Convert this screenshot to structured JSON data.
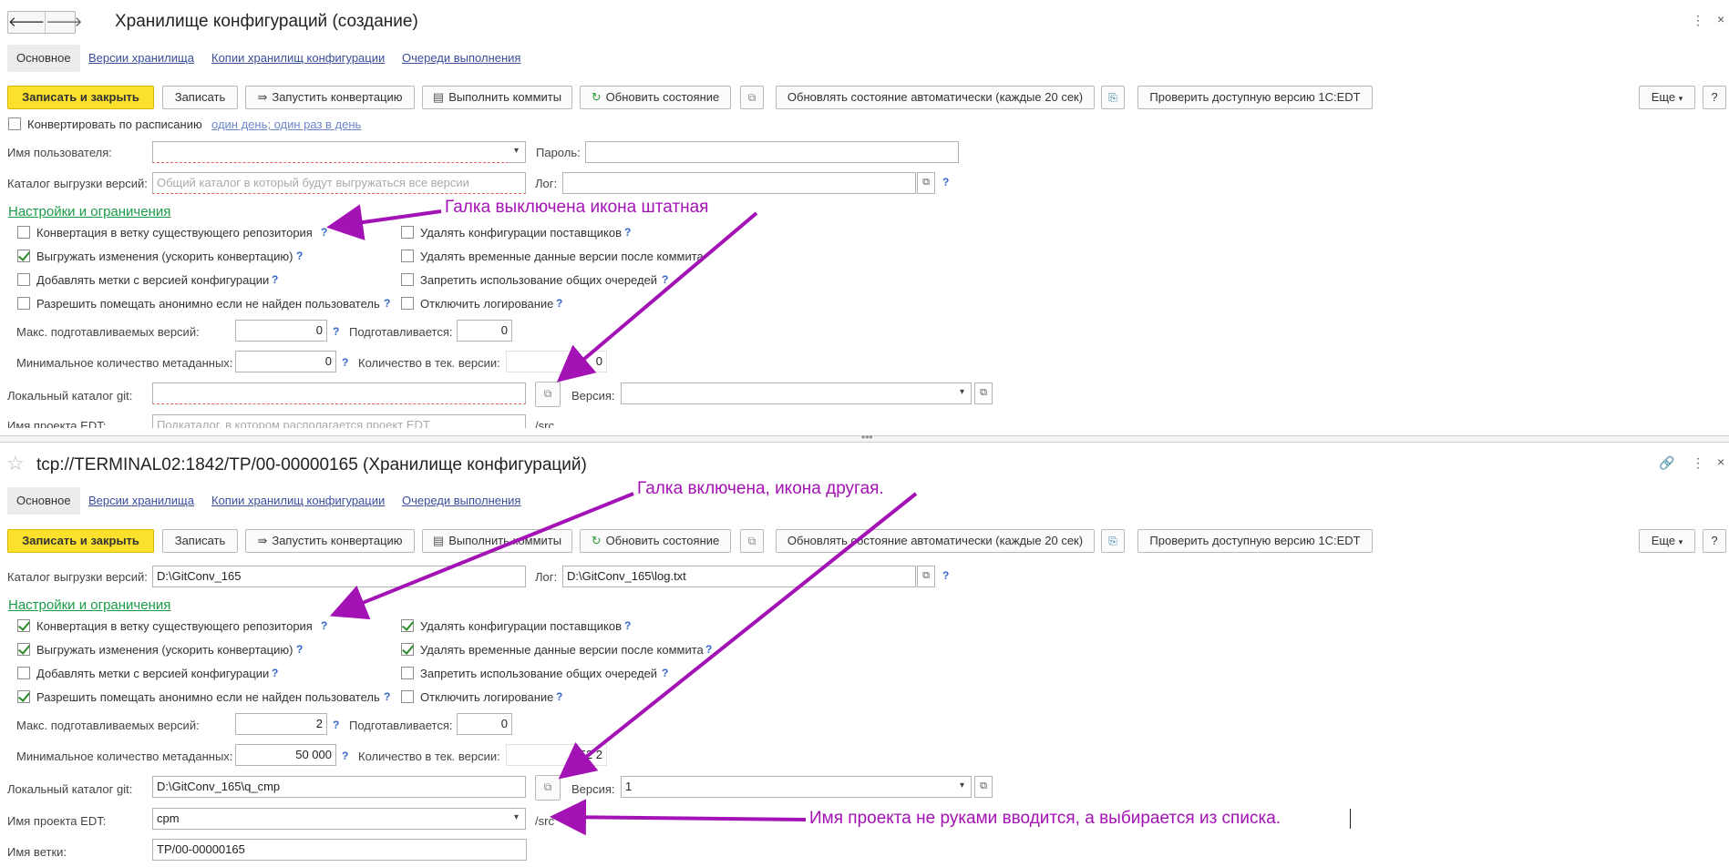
{
  "top": {
    "title": "Хранилище конфигураций (создание)",
    "tabs": {
      "main": "Основное",
      "versions": "Версии хранилища",
      "copies": "Копии хранилищ конфигурации",
      "queues": "Очереди выполнения"
    },
    "toolbar": {
      "save_close": "Записать и закрыть",
      "save": "Записать",
      "run": "Запустить конвертацию",
      "commits": "Выполнить коммиты",
      "refresh": "Обновить состояние",
      "auto_refresh": "Обновлять состояние автоматически (каждые 20 сек)",
      "check_edt": "Проверить доступную версию 1С:EDT",
      "more": "Еще",
      "help": "?"
    },
    "schedule": {
      "label": "Конвертировать по расписанию",
      "link": "один день; один раз в день"
    },
    "user": {
      "label": "Имя пользователя:",
      "value": "",
      "password_label": "Пароль:"
    },
    "catalog": {
      "label": "Каталог выгрузки версий:",
      "placeholder": "Общий каталог в который будут выгружаться все версии",
      "log_label": "Лог:",
      "log_value": ""
    },
    "section": "Настройки и ограничения",
    "options_left": [
      "Конвертация в ветку существующего репозитория",
      "Выгружать изменения (ускорить конвертацию)",
      "Добавлять метки с версией конфигурации",
      "Разрешить помещать анонимно если не найден пользователь"
    ],
    "options_right": [
      "Удалять конфигурации поставщиков",
      "Удалять временные данные версии после коммита",
      "Запретить использование общих очередей",
      "Отключить логирование"
    ],
    "max_label": "Макс. подготавливаемых версий:",
    "max_value": "0",
    "preparing_label": "Подготавливается:",
    "preparing_value": "0",
    "min_label": "Минимальное количество метаданных:",
    "min_value": "0",
    "count_label": "Количество в тек. версии:",
    "count_value": "0",
    "git_label": "Локальный каталог git:",
    "git_value": "",
    "version_label": "Версия:",
    "version_value": "",
    "edt_label": "Имя проекта EDT:",
    "edt_placeholder": "Подкаталог, в котором располагается проект EDT",
    "src": "/src"
  },
  "bottom": {
    "title": "tcp://TERMINAL02:1842/TP/00-00000165 (Хранилище конфигураций)",
    "catalog_value": "D:\\GitConv_165",
    "log_value": "D:\\GitConv_165\\log.txt",
    "max_value": "2",
    "preparing_value": "0",
    "min_value": "50 000",
    "count_value": "52 2",
    "git_value": "D:\\GitConv_165\\q_cmp",
    "version_value": "1",
    "edt_value": "cpm",
    "branch_label": "Имя ветки:",
    "branch_value": "TP/00-00000165"
  },
  "annotations": {
    "a1": "Галка выключена икона штатная",
    "a2": "Галка включена, икона другая.",
    "a3": "Имя проекта не руками вводится, а выбирается из списка."
  },
  "colors": {
    "accent_yellow": "#fbe12c",
    "annotation": "#a312b4",
    "section_green": "#1a9b46",
    "link_blue": "#3a4e9c"
  }
}
